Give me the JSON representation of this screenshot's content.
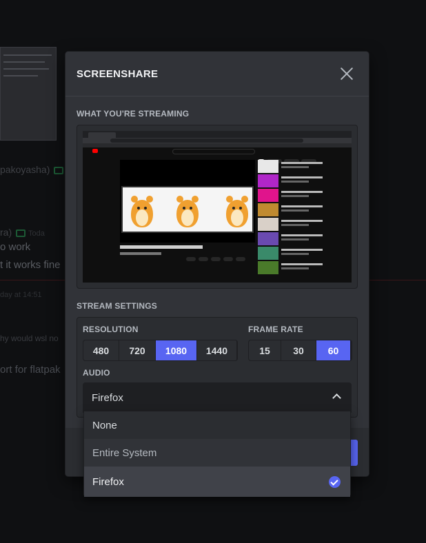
{
  "background": {
    "chat_lines": [
      "pakoyasha)",
      "ra)",
      "Toda",
      "o work",
      "t it works fine",
      "day at 14:51",
      "hy would wsl no",
      "ort for flatpak"
    ]
  },
  "modal": {
    "title": "SCREENSHARE",
    "streaming_label": "WHAT YOU'RE STREAMING",
    "stream_settings_label": "STREAM SETTINGS",
    "resolution": {
      "label": "RESOLUTION",
      "options": [
        "480",
        "720",
        "1080",
        "1440"
      ],
      "selected": "1080"
    },
    "frame_rate": {
      "label": "FRAME RATE",
      "options": [
        "15",
        "30",
        "60"
      ],
      "selected": "60"
    },
    "audio": {
      "label": "AUDIO",
      "value": "Firefox",
      "options": [
        "None",
        "Entire System",
        "Firefox"
      ],
      "selected": "Firefox"
    }
  },
  "colors": {
    "accent": "#5865f2",
    "modal_bg": "#313338",
    "panel_bg": "#2b2d31"
  },
  "icons": {
    "close": "close-icon",
    "chevron": "chevron-up-icon",
    "check": "check-circle-icon"
  }
}
